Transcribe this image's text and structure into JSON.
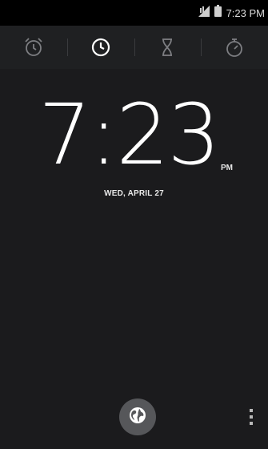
{
  "status_bar": {
    "time": "7:23 PM",
    "icons": [
      "signal-icon",
      "battery-icon"
    ]
  },
  "tabs": [
    {
      "id": "alarm",
      "icon": "alarm-clock-icon",
      "selected": false
    },
    {
      "id": "clock",
      "icon": "clock-icon",
      "selected": true
    },
    {
      "id": "timer",
      "icon": "hourglass-icon",
      "selected": false
    },
    {
      "id": "stopwatch",
      "icon": "stopwatch-icon",
      "selected": false
    }
  ],
  "clock": {
    "time": "7:23",
    "ampm": "PM",
    "date": "WED, APRIL 27"
  },
  "actions": {
    "fab_icon": "globe-icon",
    "overflow_icon": "overflow-menu-icon"
  },
  "colors": {
    "background": "#1b1b1d",
    "tab_bar": "#1f2022",
    "selected_icon": "#ffffff",
    "unselected_icon": "#7d7e82",
    "fab": "#56575a"
  }
}
